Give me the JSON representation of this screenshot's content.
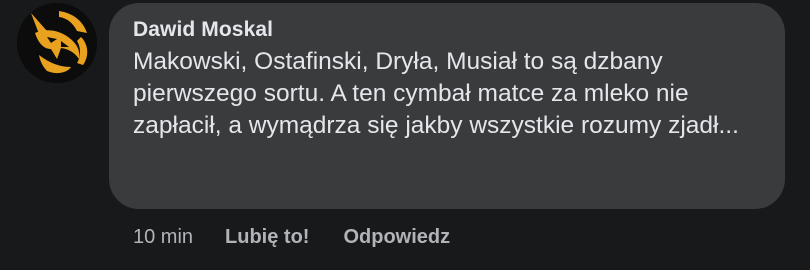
{
  "comment": {
    "avatar_icon": "fox-logo-icon",
    "author": "Dawid Moskal",
    "text": "Makowski, Ostafinski, Dryła, Musiał to są dzbany pierwszego sortu. A ten cymbał matce za mleko nie zapłacił, a wymądrza się jakby wszystkie rozumy zjadł...",
    "time": "10 min",
    "like_label": "Lubię to!",
    "reply_label": "Odpowiedz"
  },
  "colors": {
    "background": "#18191a",
    "bubble": "#3a3b3c",
    "primary_text": "#e4e6eb",
    "secondary_text": "#b0b3b8",
    "avatar_accent": "#e8a21f"
  }
}
